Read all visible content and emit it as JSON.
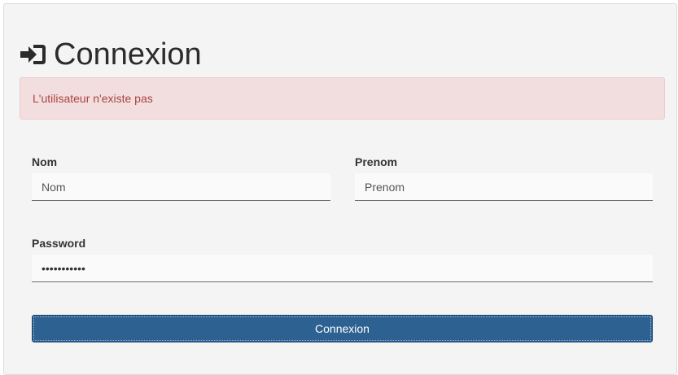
{
  "header": {
    "title": "Connexion",
    "icon": "sign-in-icon"
  },
  "alert": {
    "message": "L'utilisateur n'existe pas",
    "color": "#a94442",
    "background": "#f2dede"
  },
  "form": {
    "nom": {
      "label": "Nom",
      "placeholder": "Nom"
    },
    "prenom": {
      "label": "Prenom",
      "placeholder": "Prenom"
    },
    "password": {
      "label": "Password",
      "value": "•••••••••••"
    },
    "submit_label": "Connexion"
  },
  "colors": {
    "button": "#2d6191",
    "panel": "#f4f4f4"
  }
}
